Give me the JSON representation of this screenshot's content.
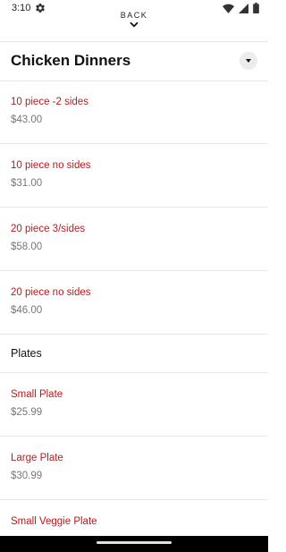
{
  "status_bar": {
    "time": "3:10",
    "icons": [
      "gear-icon",
      "wifi-icon",
      "signal-icon",
      "battery-icon"
    ]
  },
  "header": {
    "back_label": "BACK"
  },
  "section": {
    "title": "Chicken Dinners",
    "items": [
      {
        "name": "10 piece -2 sides",
        "price": "$43.00"
      },
      {
        "name": "10 piece no sides",
        "price": "$31.00"
      },
      {
        "name": "20 piece 3/sides",
        "price": "$58.00"
      },
      {
        "name": "20 piece no sides",
        "price": "$46.00"
      }
    ]
  },
  "subsection": {
    "title": "Plates",
    "items": [
      {
        "name": "Small Plate",
        "price": "$25.99"
      },
      {
        "name": "Large Plate",
        "price": "$30.99"
      },
      {
        "name": "Small Veggie Plate",
        "price": ""
      }
    ]
  },
  "colors": {
    "item_name": "#c0171b",
    "price": "#777777",
    "divider": "#e8e8e8"
  }
}
